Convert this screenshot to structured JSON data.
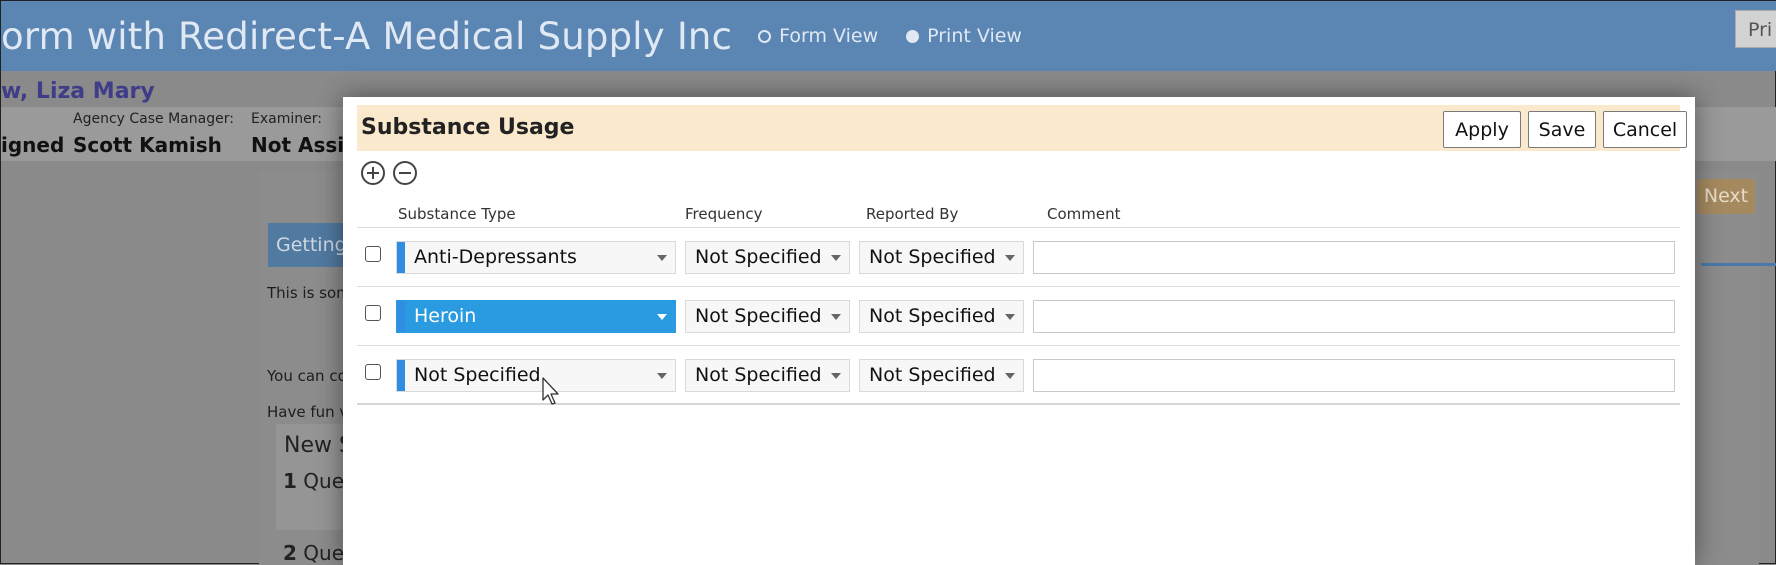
{
  "app": {
    "title": "orm with Redirect-A Medical Supply Inc",
    "views": [
      {
        "label": "Form View",
        "selected": false
      },
      {
        "label": "Print View",
        "selected": true
      }
    ],
    "print_label": "Pri"
  },
  "patient": {
    "name": "w, Liza Mary",
    "fields": [
      {
        "label": "",
        "value": "igned"
      },
      {
        "label": "Agency Case Manager:",
        "value": "Scott Kamish"
      },
      {
        "label": "Examiner:",
        "value": "Not Assig"
      }
    ]
  },
  "background": {
    "getting_tab": "Getting",
    "next_label": "Next",
    "text_lines": [
      "This is som",
      "You can co",
      "Have fun v"
    ],
    "section_title": "New S",
    "questions": [
      {
        "number": "1",
        "text": "Que"
      },
      {
        "number": "2",
        "text": "Que"
      }
    ]
  },
  "modal": {
    "title": "Substance Usage",
    "buttons": {
      "apply": "Apply",
      "save": "Save",
      "cancel": "Cancel"
    },
    "columns": {
      "substance_type": "Substance Type",
      "frequency": "Frequency",
      "reported_by": "Reported By",
      "comment": "Comment"
    },
    "rows": [
      {
        "substance_type": "Anti-Depressants",
        "frequency": "Not Specified",
        "reported_by": "Not Specified",
        "comment": "",
        "checked": false,
        "selected": false
      },
      {
        "substance_type": "Heroin",
        "frequency": "Not Specified",
        "reported_by": "Not Specified",
        "comment": "",
        "checked": false,
        "selected": true
      },
      {
        "substance_type": "Not Specified",
        "frequency": "Not Specified",
        "reported_by": "Not Specified",
        "comment": "",
        "checked": false,
        "selected": false
      }
    ]
  },
  "colors": {
    "topbar": "#5b86b3",
    "modal_header": "#fbe9cd",
    "accent_blue": "#2a9be0",
    "patient_name": "#3f3c88"
  },
  "icons": {
    "add": "plus-circle-icon",
    "remove": "minus-circle-icon",
    "dropdown": "caret-down-icon",
    "cursor": "mouse-pointer-icon"
  }
}
